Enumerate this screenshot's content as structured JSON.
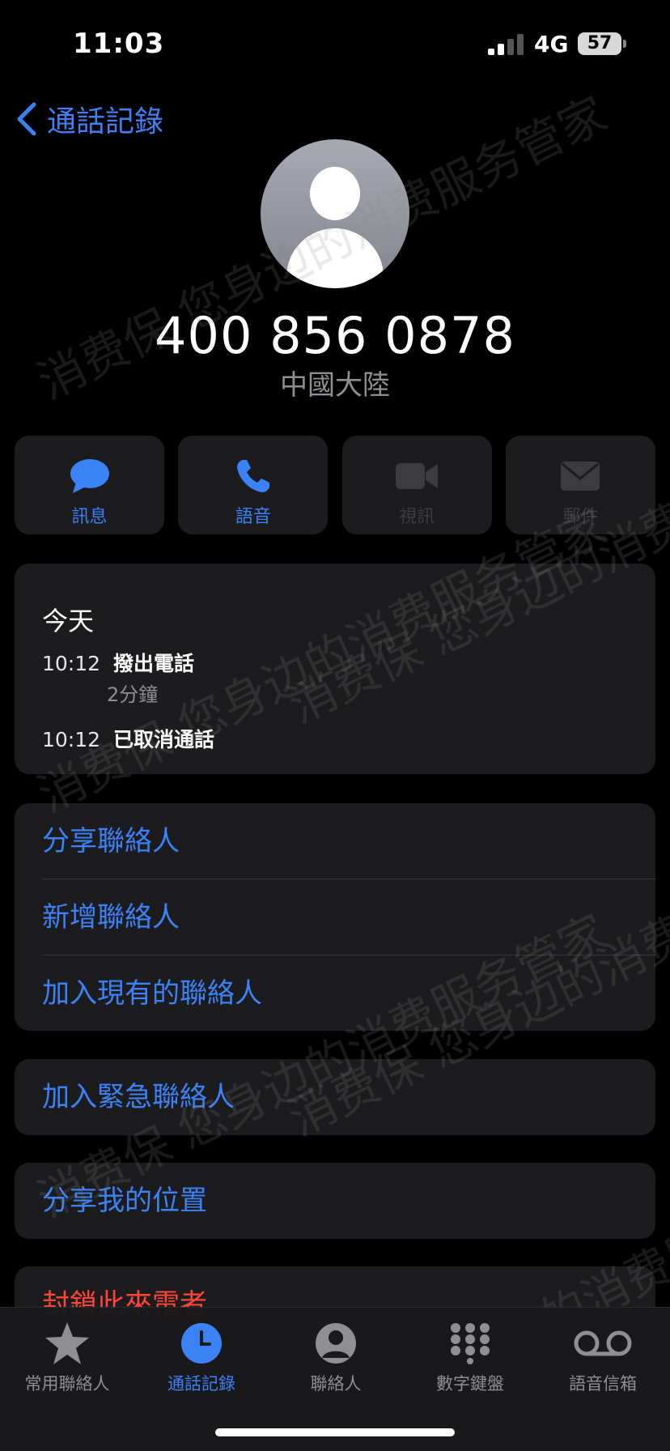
{
  "status": {
    "time": "11:03",
    "network": "4G",
    "battery": "57"
  },
  "nav": {
    "back_label": "通話記錄"
  },
  "contact": {
    "number": "400 856 0878",
    "region": "中國大陸"
  },
  "actions": [
    {
      "label": "訊息",
      "icon": "message-icon",
      "enabled": true
    },
    {
      "label": "語音",
      "icon": "phone-icon",
      "enabled": true
    },
    {
      "label": "視訊",
      "icon": "video-icon",
      "enabled": false
    },
    {
      "label": "郵件",
      "icon": "mail-icon",
      "enabled": false
    }
  ],
  "history": {
    "day": "今天",
    "entries": [
      {
        "time": "10:12",
        "desc": "撥出電話",
        "detail": "2分鐘"
      },
      {
        "time": "10:12",
        "desc": "已取消通話",
        "detail": ""
      }
    ]
  },
  "options": {
    "share_contact": "分享聯絡人",
    "new_contact": "新增聯絡人",
    "add_existing": "加入現有的聯絡人",
    "add_emergency": "加入緊急聯絡人",
    "share_location": "分享我的位置",
    "block_caller": "封鎖此來電者"
  },
  "tabs": [
    {
      "label": "常用聯絡人",
      "icon": "star-icon"
    },
    {
      "label": "通話記錄",
      "icon": "clock-icon",
      "active": true
    },
    {
      "label": "聯絡人",
      "icon": "person-circle-icon"
    },
    {
      "label": "數字鍵盤",
      "icon": "keypad-icon"
    },
    {
      "label": "語音信箱",
      "icon": "voicemail-icon"
    }
  ],
  "watermark": {
    "text": "消费保 您身边的消费服务管家"
  },
  "colors": {
    "accent": "#3b82f6",
    "destructive": "#ff453a",
    "card": "#1c1c1e",
    "background": "#000000"
  }
}
